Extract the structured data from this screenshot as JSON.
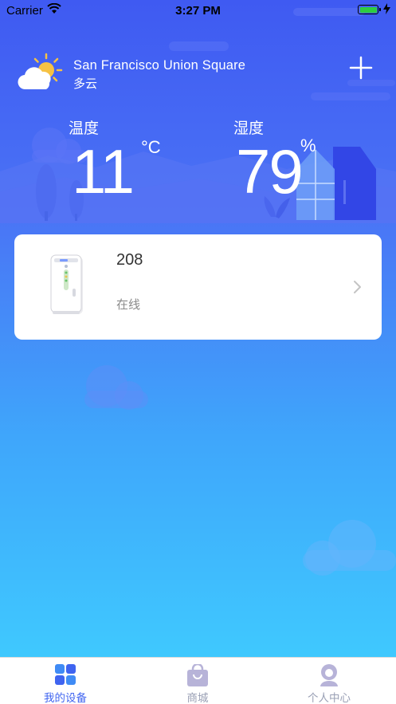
{
  "status_bar": {
    "carrier": "Carrier",
    "time": "3:27 PM"
  },
  "weather": {
    "location": "San Francisco Union Square",
    "condition": "多云",
    "icon": "partly-cloudy-icon"
  },
  "temperature": {
    "label": "温度",
    "value": "11",
    "unit": "°C"
  },
  "humidity": {
    "label": "湿度",
    "value": "79",
    "unit": "%"
  },
  "device": {
    "name": "208",
    "status": "在线",
    "icon": "dehumidifier-icon"
  },
  "tabs": [
    {
      "label": "我的设备",
      "icon": "grid-icon",
      "active": true
    },
    {
      "label": "商城",
      "icon": "shopping-bag-icon",
      "active": false
    },
    {
      "label": "个人中心",
      "icon": "user-icon",
      "active": false
    }
  ],
  "colors": {
    "accent": "#3f64f0",
    "tab_inactive": "#9aa0b5",
    "background_top": "#3f5af2",
    "background_bottom": "#3fd0ff"
  }
}
